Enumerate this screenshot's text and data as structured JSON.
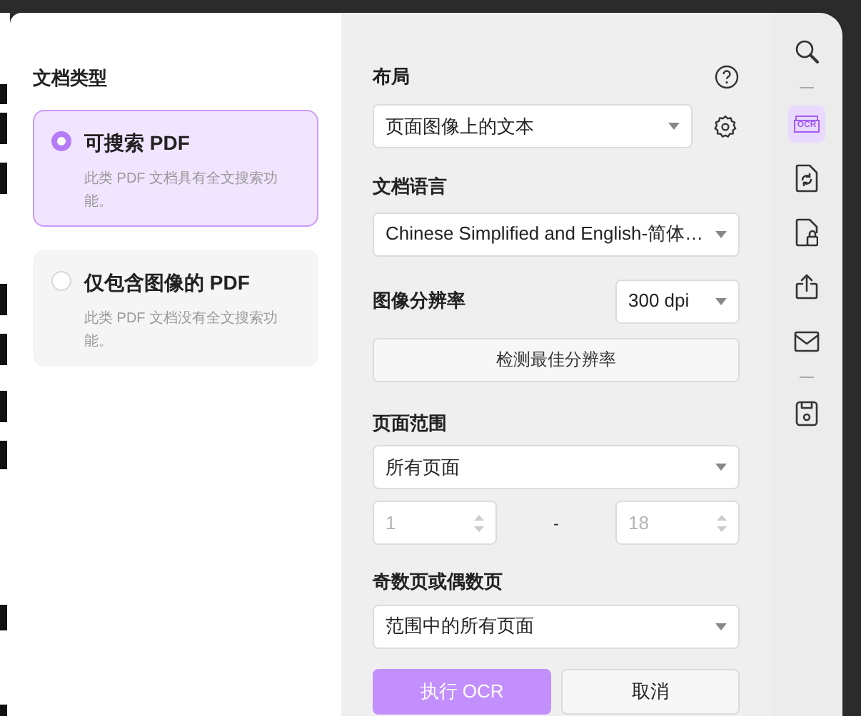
{
  "document_types": {
    "title": "文档类型",
    "options": [
      {
        "label": "可搜索 PDF",
        "description": "此类 PDF 文档具有全文搜索功能。",
        "selected": true
      },
      {
        "label": "仅包含图像的 PDF",
        "description": "此类 PDF 文档没有全文搜索功能。",
        "selected": false
      }
    ]
  },
  "layout": {
    "label": "布局",
    "value": "页面图像上的文本"
  },
  "language": {
    "label": "文档语言",
    "value": "Chinese Simplified and English-简体…"
  },
  "resolution": {
    "label": "图像分辨率",
    "value": "300 dpi",
    "detect_button": "检测最佳分辨率"
  },
  "page_range": {
    "label": "页面范围",
    "value": "所有页面",
    "from": "1",
    "separator": "-",
    "to": "18",
    "disabled": true
  },
  "odd_even": {
    "label": "奇数页或偶数页",
    "value": "范围中的所有页面"
  },
  "buttons": [
    {
      "label": "执行 OCR",
      "kind": "primary"
    },
    {
      "label": "取消",
      "kind": "secondary"
    }
  ],
  "toolbar": [
    {
      "kind": "search",
      "selected": false
    },
    {
      "kind": "divider"
    },
    {
      "kind": "ocr",
      "label": "OCR",
      "selected": true
    },
    {
      "kind": "convert",
      "selected": false
    },
    {
      "kind": "protect",
      "selected": false
    },
    {
      "kind": "share",
      "selected": false
    },
    {
      "kind": "mail",
      "selected": false
    },
    {
      "kind": "divider"
    },
    {
      "kind": "save",
      "selected": false
    }
  ]
}
